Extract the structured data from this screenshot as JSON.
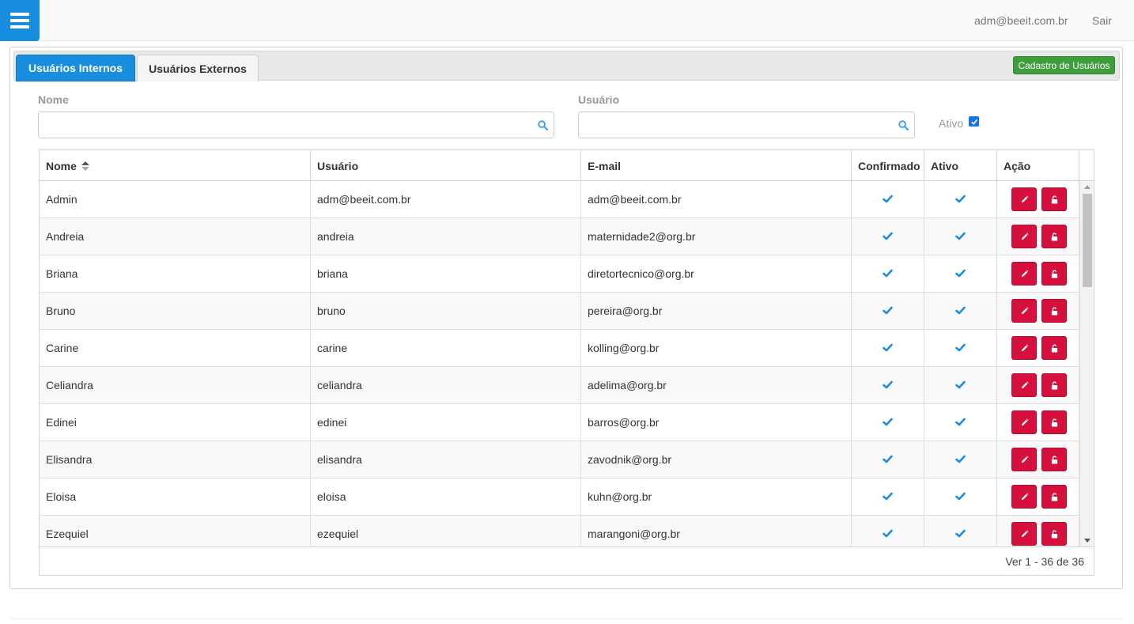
{
  "header": {
    "user_email": "adm@beeit.com.br",
    "logout_label": "Sair"
  },
  "tabs": [
    {
      "label": "Usuários Internos"
    },
    {
      "label": "Usuários Externos"
    }
  ],
  "cadastro_label": "Cadastro de Usuários",
  "filters": {
    "nome_label": "Nome",
    "nome_value": "",
    "usuario_label": "Usuário",
    "usuario_value": "",
    "ativo_label": "Ativo",
    "ativo_checked": true
  },
  "table": {
    "headers": {
      "nome": "Nome",
      "usuario": "Usuário",
      "email": "E-mail",
      "confirmado": "Confirmado",
      "ativo": "Ativo",
      "acao": "Ação"
    },
    "rows": [
      {
        "nome": "Admin",
        "usuario": "adm@beeit.com.br",
        "email": "adm@beeit.com.br"
      },
      {
        "nome": "Andreia",
        "usuario": "andreia",
        "email": "maternidade2@org.br"
      },
      {
        "nome": "Briana",
        "usuario": "briana",
        "email": "diretortecnico@org.br"
      },
      {
        "nome": "Bruno",
        "usuario": "bruno",
        "email": "pereira@org.br"
      },
      {
        "nome": "Carine",
        "usuario": "carine",
        "email": "kolling@org.br"
      },
      {
        "nome": "Celiandra",
        "usuario": "celiandra",
        "email": "adelima@org.br"
      },
      {
        "nome": "Edinei",
        "usuario": "edinei",
        "email": "barros@org.br"
      },
      {
        "nome": "Elisandra",
        "usuario": "elisandra",
        "email": "zavodnik@org.br"
      },
      {
        "nome": "Eloisa",
        "usuario": "eloisa",
        "email": "kuhn@org.br"
      },
      {
        "nome": "Ezequiel",
        "usuario": "ezequiel",
        "email": "marangoni@org.br"
      }
    ],
    "footer": "Ver 1 - 36 de 36"
  },
  "colors": {
    "primary": "#1a8ede",
    "success": "#3f9d3f",
    "danger": "#d6103c",
    "check": "#1a8ede"
  }
}
